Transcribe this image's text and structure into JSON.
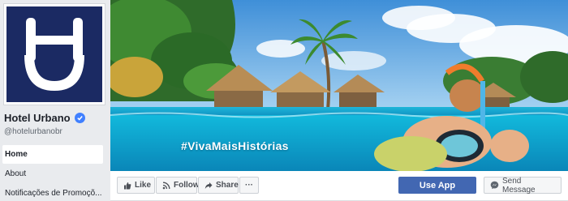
{
  "profile": {
    "page_name": "Hotel Urbano",
    "handle": "@hotelurbanobr",
    "brand_color": "#1b2a63",
    "verified_color": "#4080ff"
  },
  "nav": {
    "items": [
      {
        "label": "Home",
        "active": true
      },
      {
        "label": "About",
        "active": false
      },
      {
        "label": "Notificações de Promoçõ...",
        "active": false
      }
    ]
  },
  "cover": {
    "hashtag": "#VivaMaisHistórias"
  },
  "actions": {
    "like": "Like",
    "follow": "Follow",
    "share": "Share",
    "more": "···",
    "use_app": "Use App",
    "send_message": "Send Message",
    "primary_color": "#4267b2"
  },
  "icons": [
    "verified-badge-icon",
    "thumbs-up-icon",
    "follow-rss-icon",
    "share-arrow-icon",
    "more-dots-icon",
    "messenger-icon"
  ]
}
